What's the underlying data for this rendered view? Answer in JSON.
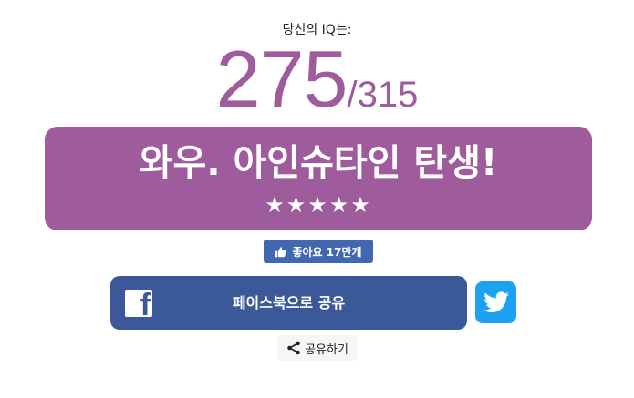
{
  "header": {
    "iq_label": "당신의 IQ는:"
  },
  "score": {
    "value": "275",
    "separator": "/",
    "max": "315"
  },
  "result": {
    "title": "와우. 아인슈타인 탄생!",
    "stars": "★★★★★",
    "rating": 5,
    "background_color": "#9e5c9c"
  },
  "like": {
    "label": "좋아요 17만개",
    "icon": "thumbs-up-icon",
    "color": "#4267b2"
  },
  "facebook_share": {
    "label": "페이스북으로 공유",
    "logo_letter": "f",
    "icon": "facebook-icon",
    "color": "#3b5998"
  },
  "twitter_share": {
    "icon": "twitter-icon",
    "color": "#1da1f2"
  },
  "share_more": {
    "label": "공유하기",
    "icon": "share-icon"
  }
}
